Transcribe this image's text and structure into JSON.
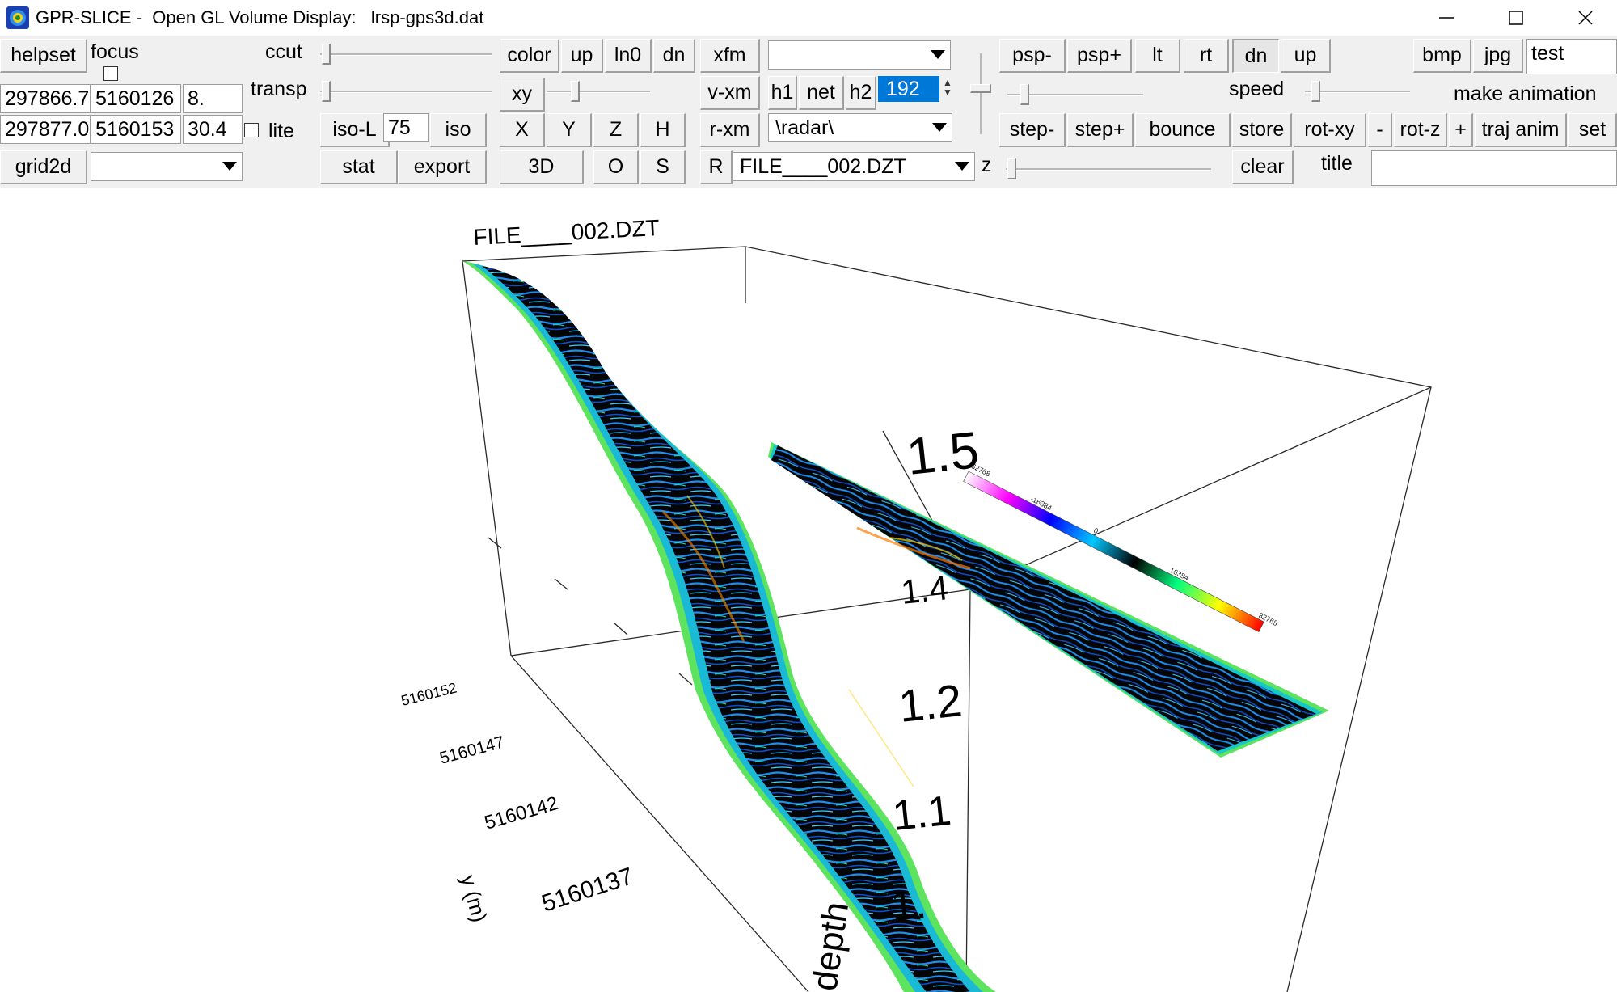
{
  "window": {
    "app_name": "GPR-SLICE -",
    "subtitle": "Open GL Volume Display:",
    "file": "lrsp-gps3d.dat",
    "minimize_icon": "minimize-icon",
    "maximize_icon": "maximize-icon",
    "close_icon": "close-icon"
  },
  "toolbar": {
    "helpset": "helpset",
    "focus": "focus",
    "ccut": "ccut",
    "transp": "transp",
    "lite": "lite",
    "grid2d": "grid2d",
    "grid2d_value": "",
    "coords": {
      "x1": "297866.7",
      "y1": "5160126",
      "z1": "8.",
      "x2": "297877.0",
      "y2": "5160153",
      "z2": "30.4"
    },
    "iso_l": "iso-L",
    "iso_value": "75",
    "iso": "iso",
    "stat": "stat",
    "export": "export",
    "color": "color",
    "color_up": "up",
    "ln0": "ln0",
    "color_dn": "dn",
    "xy": "xy",
    "x": "X",
    "y": "Y",
    "z": "Z",
    "h": "H",
    "three_d": "3D",
    "o": "O",
    "s": "S",
    "xfm": "xfm",
    "xfm_value": "",
    "v_xm": "v-xm",
    "h1": "h1",
    "net": "net",
    "h2": "h2",
    "h2_value": "192",
    "r_xm": "r-xm",
    "radar_path": "\\radar\\",
    "r": "R",
    "file_select": "FILE____002.DZT",
    "z_label": "z",
    "psp_minus": "psp-",
    "psp_plus": "psp+",
    "lt": "lt",
    "rt": "rt",
    "dn": "dn",
    "up": "up",
    "speed": "speed",
    "step_minus": "step-",
    "step_plus": "step+",
    "bounce": "bounce",
    "store": "store",
    "rot_xy": "rot-xy",
    "minus": "-",
    "rot_z": "rot-z",
    "plus": "+",
    "traj_anim": "traj anim",
    "set": "set",
    "clear": "clear",
    "title_label": "title",
    "title_value": "",
    "bmp": "bmp",
    "jpg": "jpg",
    "test": "test",
    "make_animation": "make animation"
  },
  "viewport": {
    "file_label": "FILE____002.DZT",
    "y_axis_label": "y (m)",
    "depth_axis_label": "depth",
    "y_ticks": [
      "5160152",
      "5160147",
      "5160142",
      "5160137"
    ],
    "depth_ticks": [
      "1.5",
      "1.4",
      "1.2",
      "1.1",
      "1."
    ],
    "colorbar_ticks": [
      "-32768",
      "-16384",
      "0",
      "16384",
      "32768"
    ],
    "colorbar_colors": [
      "#ffffff",
      "#ff00ff",
      "#0000ff",
      "#00c8ff",
      "#000000",
      "#00ff80",
      "#ffff00",
      "#ff0000"
    ]
  }
}
